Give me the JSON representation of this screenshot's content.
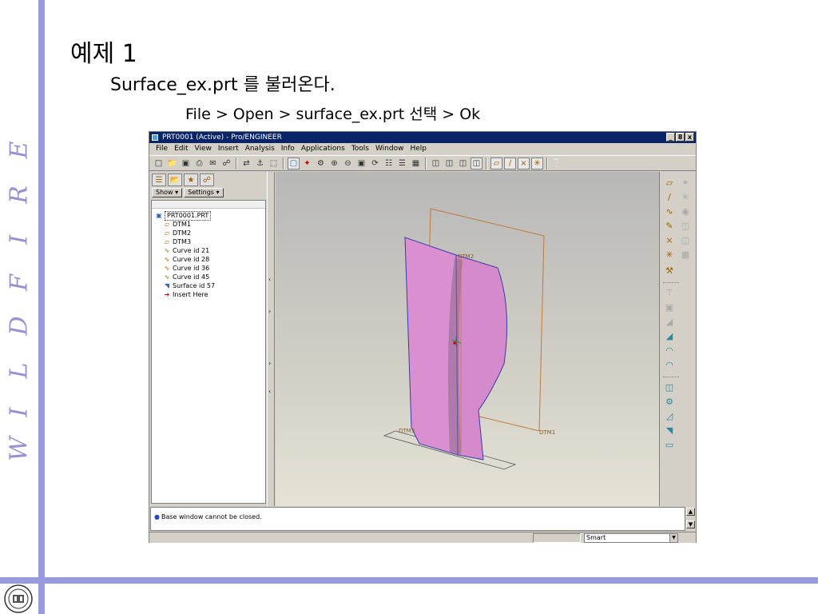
{
  "slide": {
    "title": "예제 1",
    "subtitle": "Surface_ex.prt 를 불러온다.",
    "path": "File > Open > surface_ex.prt  선택 > Ok",
    "side_letters": [
      "E",
      "R",
      "I",
      "F",
      "D",
      "L",
      "I",
      "W"
    ],
    "accent_color": "#9999dd"
  },
  "window": {
    "title": "PRT0001 (Active) - Pro/ENGINEER",
    "controls": [
      "_",
      "8",
      "x"
    ]
  },
  "menu": [
    "File",
    "Edit",
    "View",
    "Insert",
    "Analysis",
    "Info",
    "Applications",
    "Tools",
    "Window",
    "Help"
  ],
  "navigator": {
    "show_label": "Show ▾",
    "settings_label": "Settings ▾",
    "tree": [
      {
        "label": "PRT0001.PRT",
        "icon": "part-icon"
      },
      {
        "label": "DTM1",
        "icon": "datum-plane-icon"
      },
      {
        "label": "DTM2",
        "icon": "datum-plane-icon"
      },
      {
        "label": "DTM3",
        "icon": "datum-plane-icon"
      },
      {
        "label": "Curve id 21",
        "icon": "curve-icon"
      },
      {
        "label": "Curve id 28",
        "icon": "curve-icon"
      },
      {
        "label": "Curve id 36",
        "icon": "curve-icon"
      },
      {
        "label": "Curve id 45",
        "icon": "curve-icon"
      },
      {
        "label": "Surface id 57",
        "icon": "surface-icon"
      },
      {
        "label": "Insert Here",
        "icon": "insert-arrow-icon"
      }
    ]
  },
  "viewport": {
    "labels": {
      "dtm1": "DTM1",
      "dtm2": "DTM2",
      "dtm3": "DTM3"
    },
    "surface_color": "#d98fd0",
    "datum_color": "#c07a3a"
  },
  "message": {
    "text": "Base window cannot be closed."
  },
  "status": {
    "filter_value": "Smart"
  }
}
